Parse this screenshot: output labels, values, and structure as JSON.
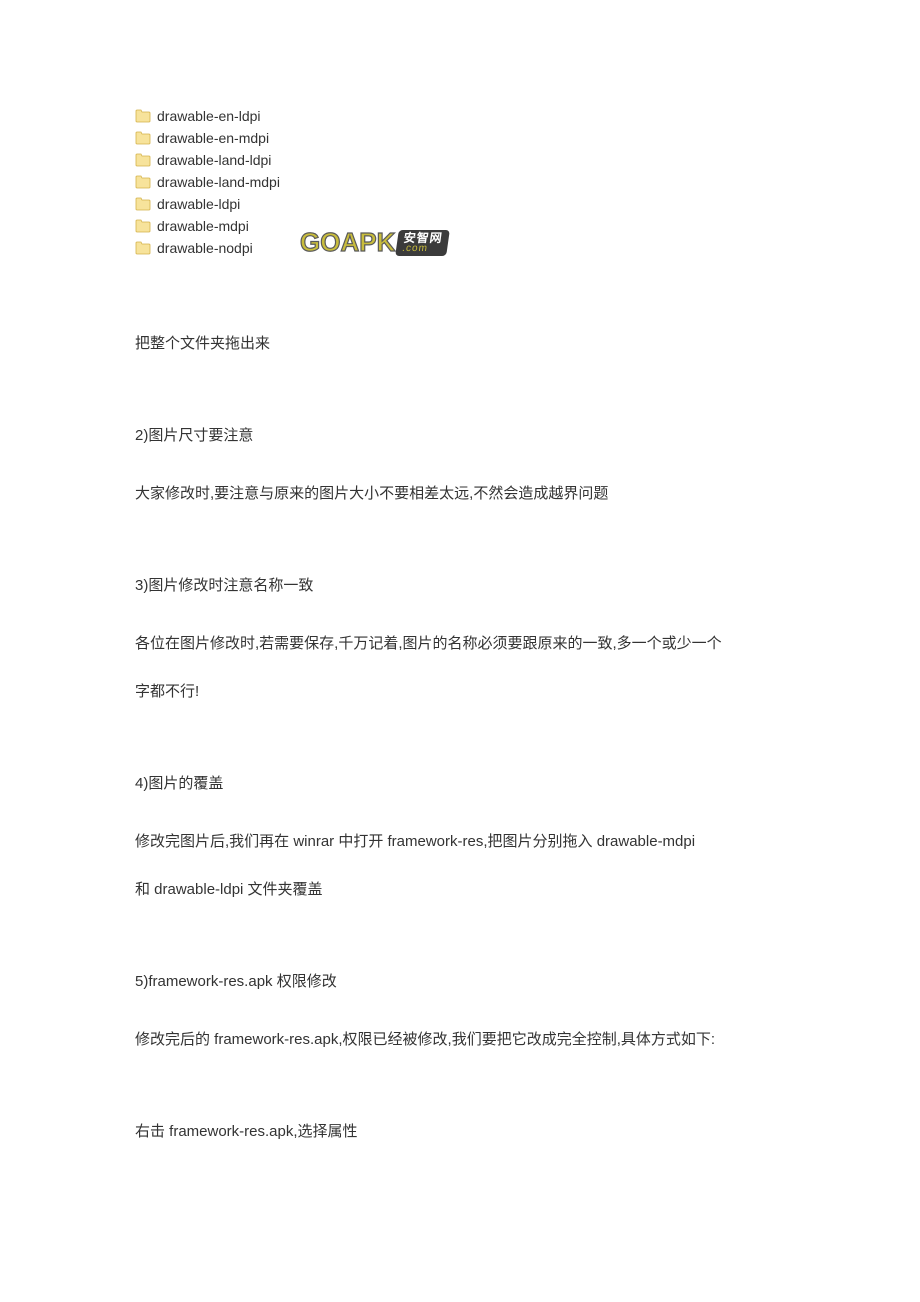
{
  "folders": [
    "drawable-en-ldpi",
    "drawable-en-mdpi",
    "drawable-land-ldpi",
    "drawable-land-mdpi",
    "drawable-ldpi",
    "drawable-mdpi",
    "drawable-nodpi"
  ],
  "watermark": {
    "left": "GOAPK",
    "right_top": "安智网",
    "right_bottom": ".com"
  },
  "lines": {
    "l1": "把整个文件夹拖出来",
    "l2": "2)图片尺寸要注意",
    "l3": "大家修改时,要注意与原来的图片大小不要相差太远,不然会造成越界问题",
    "l4": "3)图片修改时注意名称一致",
    "l5": "各位在图片修改时,若需要保存,千万记着,图片的名称必须要跟原来的一致,多一个或少一个",
    "l6": "字都不行!",
    "l7": "4)图片的覆盖",
    "l8": "修改完图片后,我们再在 winrar 中打开 framework-res,把图片分别拖入 drawable-mdpi",
    "l9": "和 drawable-ldpi 文件夹覆盖",
    "l10": "5)framework-res.apk 权限修改",
    "l11": "修改完后的 framework-res.apk,权限已经被修改,我们要把它改成完全控制,具体方式如下:",
    "l12": "右击 framework-res.apk,选择属性"
  }
}
